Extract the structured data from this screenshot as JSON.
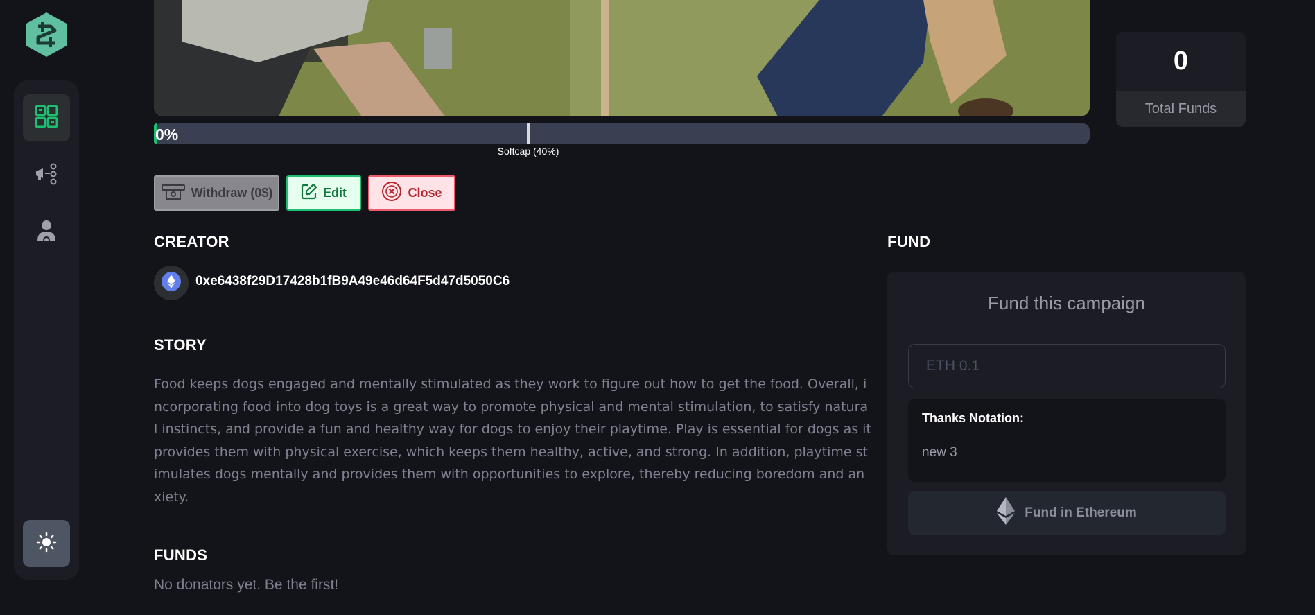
{
  "campaign": {
    "progress_label": "0%",
    "progress_fraction": 0,
    "softcap_label": "Softcap (40%)",
    "softcap_fraction": 0.4
  },
  "stats": {
    "total_funds_value": "0",
    "total_funds_label": "Total Funds"
  },
  "actions": {
    "withdraw_label": "Withdraw (0$)",
    "edit_label": "Edit",
    "close_label": "Close"
  },
  "creator": {
    "heading": "CREATOR",
    "address": "0xe6438f29D17428b1fB9A49e46d64F5d47d5050C6"
  },
  "story": {
    "heading": "STORY",
    "text": "Food keeps dogs engaged and mentally stimulated as they work to figure out how to get the food. Overall, incorporating food into dog toys is a great way to promote physical and mental stimulation, to satisfy natural instincts, and provide a fun and healthy way for dogs to enjoy their playtime. Play is essential for dogs as it provides them with physical exercise, which keeps them healthy, active, and strong. In addition, playtime stimulates dogs mentally and provides them with opportunities to explore, thereby reducing boredom and anxiety."
  },
  "funds": {
    "heading": "FUNDS",
    "empty_text": "No donators yet. Be the first!"
  },
  "fund": {
    "heading": "FUND",
    "card_title": "Fund this campaign",
    "input_placeholder": "ETH 0.1",
    "input_value": "",
    "thanks_label": "Thanks Notation:",
    "thanks_value": "new 3",
    "button_label": "Fund in Ethereum"
  },
  "colors": {
    "accent_green": "#1dc071",
    "background": "#13131a",
    "card": "#1c1c24"
  },
  "icons": {
    "logo": "logo-icon",
    "nav": [
      "dashboard-icon",
      "campaign-icon",
      "profile-icon"
    ],
    "theme": "sun-icon",
    "eth": "ethereum-icon"
  }
}
